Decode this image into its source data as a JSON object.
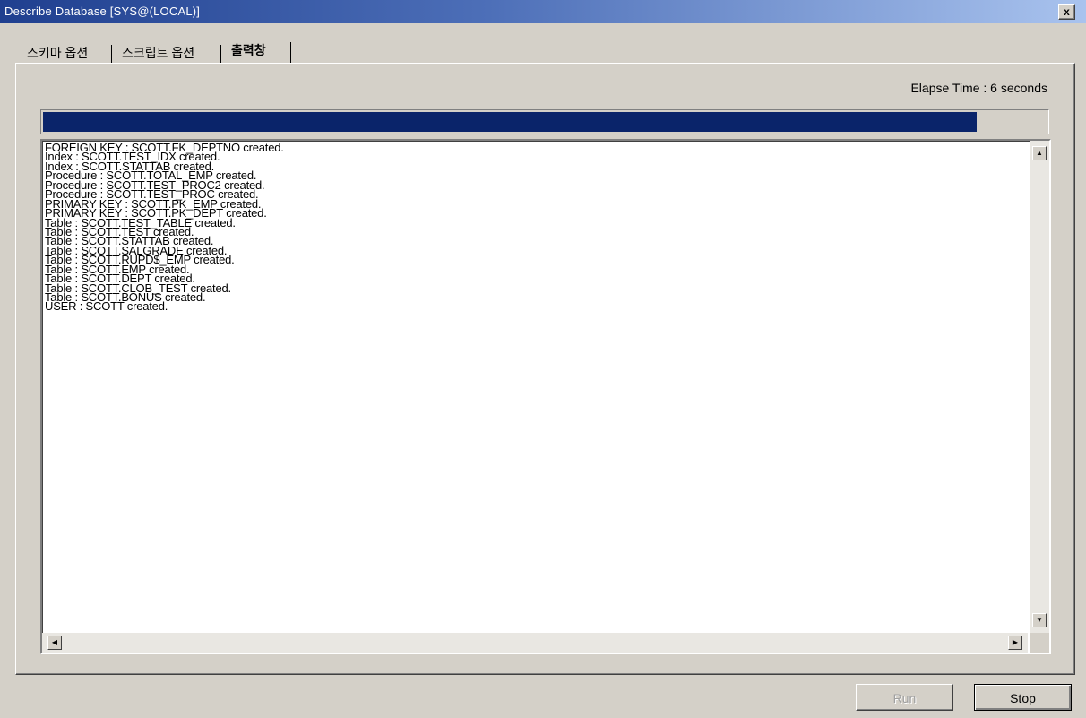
{
  "window": {
    "title": "Describe Database [SYS@(LOCAL)]",
    "close_label": "x"
  },
  "tabs": [
    {
      "label": "스키마 옵션",
      "active": false
    },
    {
      "label": "스크립트 옵션",
      "active": false
    },
    {
      "label": "출력창",
      "active": true
    }
  ],
  "status": {
    "elapse_text": "Elapse Time : 6 seconds",
    "progress": 0.93
  },
  "log": {
    "lines": [
      "FOREIGN KEY : SCOTT.FK_DEPTNO created.",
      "Index : SCOTT.TEST_IDX created.",
      "Index : SCOTT.STATTAB created.",
      "Procedure : SCOTT.TOTAL_EMP created.",
      "Procedure : SCOTT.TEST_PROC2 created.",
      "Procedure : SCOTT.TEST_PROC created.",
      "PRIMARY KEY : SCOTT.PK_EMP created.",
      "PRIMARY KEY : SCOTT.PK_DEPT created.",
      "Table : SCOTT.TEST_TABLE created.",
      "Table : SCOTT.TEST created.",
      "Table : SCOTT.STATTAB created.",
      "Table : SCOTT.SALGRADE created.",
      "Table : SCOTT.RUPD$_EMP created.",
      "Table : SCOTT.EMP created.",
      "Table : SCOTT.DEPT created.",
      "Table : SCOTT.CLOB_TEST created.",
      "Table : SCOTT.BONUS created.",
      "USER : SCOTT created."
    ]
  },
  "buttons": {
    "run_label": "Run",
    "stop_label": "Stop"
  }
}
